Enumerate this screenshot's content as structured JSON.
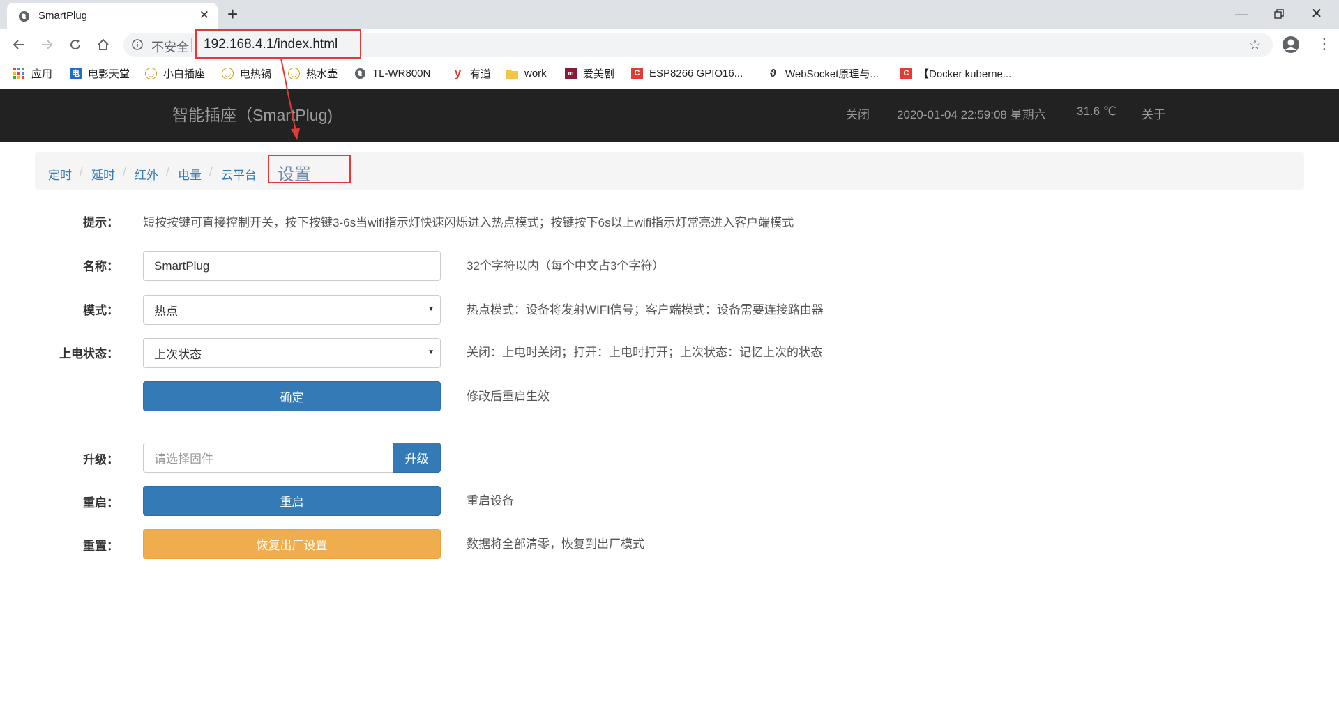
{
  "browser": {
    "tab_title": "SmartPlug",
    "insecure_label": "不安全",
    "url": "192.168.4.1/index.html",
    "bookmarks": [
      {
        "label": "应用",
        "icon": "apps-grid-icon"
      },
      {
        "label": "电影天堂",
        "icon": "movie-site-icon"
      },
      {
        "label": "小白插座",
        "icon": "plug-smile-icon"
      },
      {
        "label": "电热锅",
        "icon": "plug-smile-icon"
      },
      {
        "label": "热水壶",
        "icon": "plug-smile-icon"
      },
      {
        "label": "TL-WR800N",
        "icon": "globe-icon"
      },
      {
        "label": "有道",
        "icon": "youdao-icon"
      },
      {
        "label": "work",
        "icon": "folder-icon"
      },
      {
        "label": "爱美剧",
        "icon": "site-icon"
      },
      {
        "label": "ESP8266 GPIO16...",
        "icon": "csdn-icon"
      },
      {
        "label": "WebSocket原理与...",
        "icon": "site-icon"
      },
      {
        "label": "【Docker kuberne...",
        "icon": "csdn-icon"
      }
    ]
  },
  "navbar": {
    "brand": "智能插座（SmartPlug)",
    "links": [
      "关闭",
      "2020-01-04 22:59:08 星期六",
      "31.6 ℃",
      "关于"
    ]
  },
  "breadcrumb": {
    "items": [
      "定时",
      "延时",
      "红外",
      "电量",
      "云平台"
    ],
    "separator": "/",
    "active": "设置"
  },
  "form": {
    "hint_label": "提示：",
    "hint_text": "短按按键可直接控制开关，按下按键3-6s当wifi指示灯快速闪烁进入热点模式；按键按下6s以上wifi指示灯常亮进入客户端模式",
    "name_label": "名称：",
    "name_value": "SmartPlug",
    "name_help": "32个字符以内（每个中文占3个字符）",
    "mode_label": "模式：",
    "mode_value": "热点",
    "mode_help": "热点模式：设备将发射WIFI信号；客户端模式：设备需要连接路由器",
    "power_label": "上电状态：",
    "power_value": "上次状态",
    "power_help": "关闭：上电时关闭；打开：上电时打开；上次状态：记忆上次的状态",
    "confirm_button": "确定",
    "confirm_help": "修改后重启生效",
    "upgrade_label": "升级：",
    "upgrade_placeholder": "请选择固件",
    "upgrade_button": "升级",
    "reboot_label": "重启：",
    "reboot_button": "重启",
    "reboot_help": "重启设备",
    "reset_label": "重置：",
    "reset_button": "恢复出厂设置",
    "reset_help": "数据将全部清零，恢复到出厂模式"
  },
  "colors": {
    "navbar_bg": "#222222",
    "primary": "#337ab7",
    "warning": "#f0ad4e",
    "annotation": "#e53935"
  }
}
